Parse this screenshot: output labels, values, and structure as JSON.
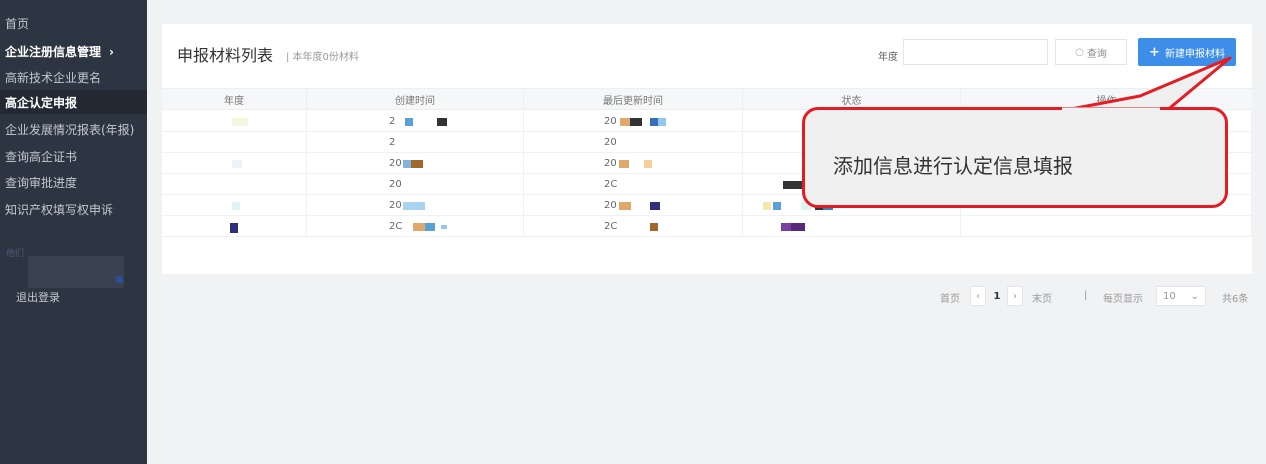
{
  "sidebar": {
    "items": [
      {
        "label": "首页"
      },
      {
        "label": "企业注册信息管理"
      },
      {
        "label": "高新技术企业更名"
      },
      {
        "label": "高企认定申报"
      },
      {
        "label": "企业发展情况报表(年报)"
      },
      {
        "label": "查询高企证书"
      },
      {
        "label": "查询审批进度"
      },
      {
        "label": "知识产权填写权申诉"
      }
    ],
    "group_chevron": "›",
    "small_label": "他们",
    "logout_label": "退出登录"
  },
  "panel": {
    "title": "申报材料列表",
    "subtitle": "| 本年度0份材料",
    "year_label": "年度",
    "year_value": "",
    "query_label": "查询",
    "new_label": "新建申报材料",
    "new_plus": "+"
  },
  "table": {
    "headers": [
      "年度",
      "创建时间",
      "最后更新时间",
      "状态",
      "操作"
    ],
    "rows": [
      {
        "created": "2",
        "updated": "20"
      },
      {
        "created": "2",
        "updated": "20"
      },
      {
        "created": "20",
        "updated": "20"
      },
      {
        "created": "20",
        "updated": "2C"
      },
      {
        "created": "20",
        "updated": "20"
      },
      {
        "created": "2C",
        "updated": "2C"
      }
    ]
  },
  "pagination": {
    "first": "首页",
    "prev": "‹",
    "current": "1",
    "next": "›",
    "last": "末页",
    "separator": "|",
    "per_page_label": "每页显示",
    "per_page_value": "10",
    "total": "共6条"
  },
  "callout": {
    "text": "添加信息进行认定信息填报",
    "border_color": "#e51c23"
  },
  "colors": {
    "sidebar_bg": "#2e3542",
    "accent_blue": "#3d8ee8",
    "page_bg": "#f1f2f4"
  }
}
